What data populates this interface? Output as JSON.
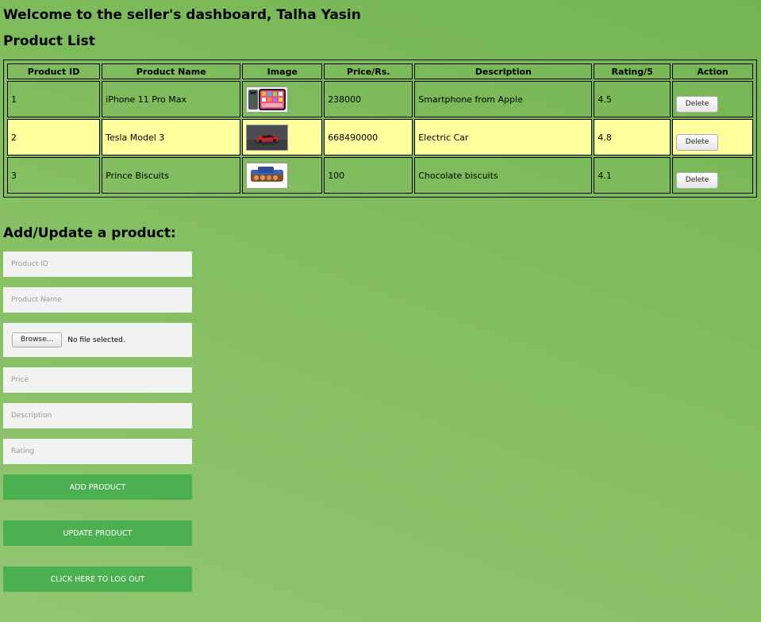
{
  "header": {
    "welcome": "Welcome to the seller's dashboard, Talha Yasin",
    "list_title": "Product List"
  },
  "table": {
    "headers": [
      "Product ID",
      "Product Name",
      "Image",
      "Price/Rs.",
      "Description",
      "Rating/5",
      "Action"
    ],
    "rows": [
      {
        "id": "1",
        "name": "iPhone 11 Pro Max",
        "image": "iphone-thumbnail",
        "price": "238000",
        "description": "Smartphone from Apple",
        "rating": "4.5",
        "action": "Delete"
      },
      {
        "id": "2",
        "name": "Tesla Model 3",
        "image": "tesla-car-thumbnail",
        "price": "668490000",
        "description": "Electric Car",
        "rating": "4.8",
        "action": "Delete"
      },
      {
        "id": "3",
        "name": "Prince Biscuits",
        "image": "biscuits-pack-thumbnail",
        "price": "100",
        "description": "Chocolate biscuits",
        "rating": "4.1",
        "action": "Delete"
      }
    ]
  },
  "form": {
    "title": "Add/Update a product:",
    "product_id_placeholder": "Product ID",
    "product_name_placeholder": "Product Name",
    "browse_label": "Browse...",
    "file_status": "No file selected.",
    "price_placeholder": "Price",
    "description_placeholder": "Description",
    "rating_placeholder": "Rating",
    "add_label": "ADD PRODUCT",
    "update_label": "UPDATE PRODUCT",
    "logout_label": "CLICK HERE TO LOG OUT"
  },
  "colors": {
    "background": "#7db95c",
    "highlight_row": "#ffff9e",
    "button": "#4caf50",
    "input": "#f2f2f2"
  }
}
